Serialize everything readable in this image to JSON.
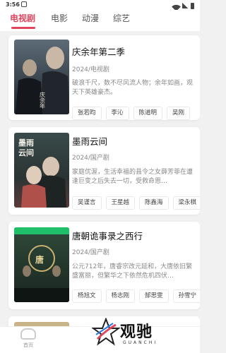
{
  "status": {
    "time": "3:56"
  },
  "tabs": [
    {
      "label": "电视剧",
      "active": true
    },
    {
      "label": "电影",
      "active": false
    },
    {
      "label": "动漫",
      "active": false
    },
    {
      "label": "综艺",
      "active": false
    }
  ],
  "shows": [
    {
      "title": "庆余年第二季",
      "meta": "2024/电视剧",
      "desc": "破浪千尺，数不尽风流人物；余年如画，观天下英雄豪杰。",
      "actors": [
        "张若昀",
        "李沁",
        "陈道明",
        "吴刚"
      ],
      "poster_text": "庆余年"
    },
    {
      "title": "墨雨云间",
      "meta": "2024/国产剧",
      "desc": "家庭优渥，生活幸福的县令之女薛芳菲在遭逢巨变之后失去一切，受救命恩…",
      "actors": [
        "吴谨言",
        "王星越",
        "陈鑫海",
        "梁永棋"
      ],
      "poster_text": "墨雨云间"
    },
    {
      "title": "唐朝诡事录之西行",
      "meta": "2024/国产剧",
      "desc": "公元712年，唐睿宗改元延和，大唐依旧繁盛富丽，但繁华之下依然危机四伏…",
      "actors": [
        "杨旭文",
        "杨志刚",
        "郜思雯",
        "孙雪宁"
      ],
      "poster_text": "唐朝诡事录之西行"
    }
  ],
  "bottom_nav": {
    "home_label": "首页"
  },
  "logo": {
    "text": "观驰",
    "sub": "GUANCHI"
  },
  "colors": {
    "accent": "#e0455c"
  }
}
